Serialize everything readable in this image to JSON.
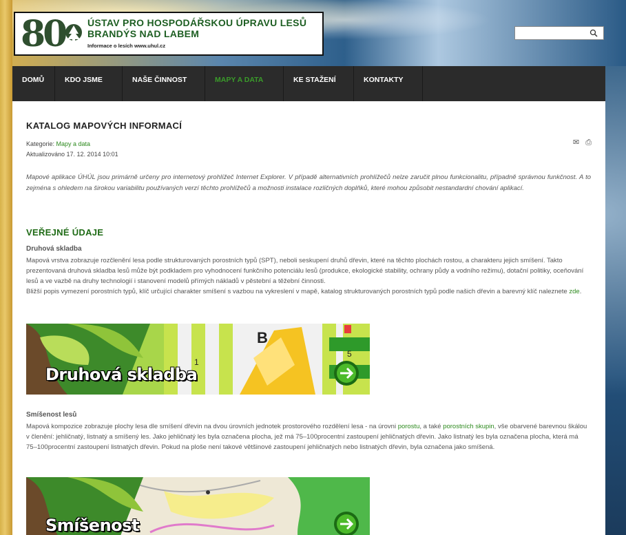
{
  "header": {
    "logo_number": "80",
    "title_line1": "ÚSTAV PRO HOSPODÁŘSKOU ÚPRAVU LESŮ",
    "title_line2": "BRANDÝS NAD LABEM",
    "subtitle": "Informace o lesích www.uhul.cz",
    "search_placeholder": ""
  },
  "nav": {
    "items": [
      {
        "label": "DOMŮ",
        "has_menu": false
      },
      {
        "label": "KDO JSME",
        "has_menu": true
      },
      {
        "label": "NAŠE ČINNOST",
        "has_menu": true
      },
      {
        "label": "MAPY A DATA",
        "has_menu": true,
        "active": true
      },
      {
        "label": "KE STAŽENÍ",
        "has_menu": true
      },
      {
        "label": "KONTAKTY",
        "has_menu": true
      }
    ],
    "chevron": "⌄"
  },
  "article": {
    "title": "KATALOG MAPOVÝCH INFORMACÍ",
    "category_label": "Kategorie: ",
    "category_link": "Mapy a data",
    "updated": "Aktualizováno 17. 12. 2014 10:01",
    "email_icon": "envelope-icon",
    "print_icon": "printer-icon",
    "intro": "Mapové aplikace ÚHÚL jsou primárně určeny pro internetový prohlížeč Internet Explorer. V případě alternativních prohlížečů nelze zaručit plnou funkcionalitu, případně správnou funkčnost. A to zejména s ohledem na širokou variabilitu používaných verzí těchto prohlížečů a možnosti instalace rozličných doplňků, které mohou způsobit nestandardní chování aplikací.",
    "section_title": "VEŘEJNÉ ÚDAJE",
    "sections": [
      {
        "title": "Druhová skladba",
        "text1": "Mapová vrstva zobrazuje rozčlenění lesa podle strukturovaných porostních typů (SPT), neboli seskupení druhů dřevin, které na těchto plochách rostou, a charakteru jejich smíšení. Takto prezentovaná druhová skladba lesů může být podkladem pro vyhodnocení funkčního potenciálu lesů (produkce, ekologické stability, ochrany půdy a vodního režimu), dotační politiky, oceňování lesů a ve vazbě na druhy technologií i stanovení modelů přímých nákladů v pěstební a těžební činnosti.",
        "text2": "Bližší popis vymezení porostních typů, klíč určující charakter smíšení s vazbou na vykreslení v mapě, katalog strukturovaných porostních typů podle našich dřevin a barevný klíč naleznete ",
        "link": "zde",
        "text2_end": ".",
        "banner_label": "Druhová skladba"
      },
      {
        "title": "Smíšenost lesů",
        "text_a": "Mapová kompozice zobrazuje plochy lesa dle smíšení dřevin na dvou úrovních jednotek prostorového rozdělení lesa - na úrovni ",
        "link1": "porostu",
        "text_b": ", a také ",
        "link2": "porostních skupin",
        "text_c": ", vše obarvené barevnou škálou v členění: jehličnatý, listnatý a smíšený les. Jako jehličnatý les byla označena plocha, jež má 75–100procentní zastoupení jehličnatých dřevin. Jako listnatý les byla označena plocha, která má 75–100procentní zastoupení listnatých dřevin. Pokud na ploše není takové většinové zastoupení jehličnatých nebo listnatých dřevin, byla označena jako smíšená.",
        "banner_label": "Smíšenost"
      }
    ]
  },
  "colors": {
    "nav_bg": "#2b2b2b",
    "accent_green": "#2d8a1e",
    "section_green": "#1f6b16"
  }
}
